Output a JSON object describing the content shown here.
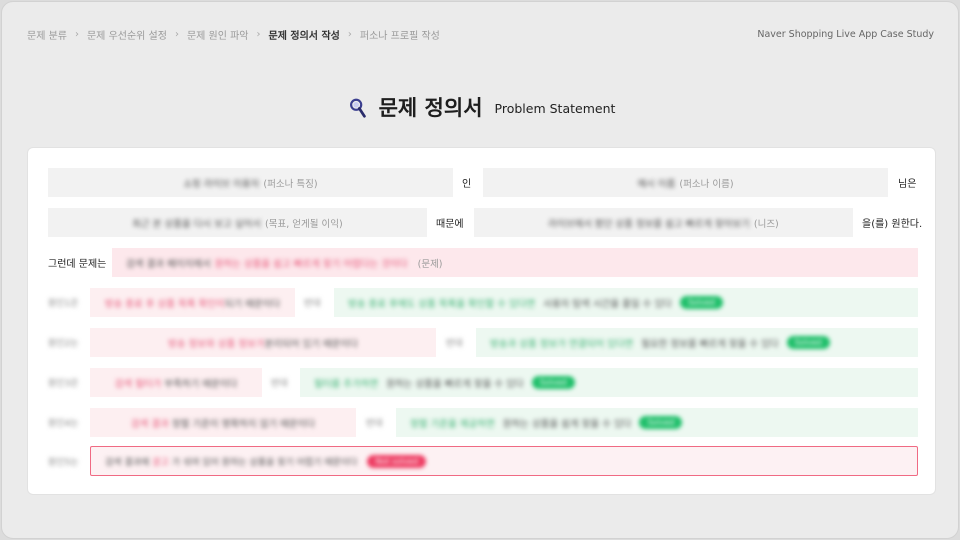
{
  "breadcrumb": {
    "items": [
      {
        "label": "문제 분류"
      },
      {
        "label": "문제 우선순위 설정"
      },
      {
        "label": "문제 원인 파악"
      },
      {
        "label": "문제 정의서 작성"
      },
      {
        "label": "퍼소나 프로필 작성"
      }
    ],
    "active_index": 3
  },
  "brand": "Naver Shopping Live App Case Study",
  "header": {
    "title_ko": "문제 정의서",
    "title_en": "Problem Statement",
    "icon": "magnifier-icon"
  },
  "statement": {
    "row1": {
      "persona_feature_value": "쇼핑 라이브 이용자",
      "persona_feature_placeholder": "(퍼소나 특징)",
      "connector_in": "인",
      "persona_name_value": "예시 이름",
      "persona_name_placeholder": "(퍼소나 이름)",
      "suffix": "님은"
    },
    "row2": {
      "goal_value": "최근 본 상품을 다시 보고 싶어서",
      "goal_placeholder": "(목표, 얻게될 이익)",
      "connector_because": "때문에",
      "need_value": "라이브에서 봤던 상품 정보를 쉽고 빠르게 찾아보기",
      "need_placeholder": "(니즈)",
      "suffix": "을(를) 원한다."
    },
    "row3": {
      "label": "그런데 문제는",
      "value_prefix": "검색 결과 페이지에서",
      "value_highlight": "원하는 상품을 쉽고 빠르게 찾기 어렵다는 것이다",
      "placeholder": "(문제)"
    }
  },
  "causes": [
    {
      "label": "원인1은",
      "left_highlight": "방송 종료 후 상품 목록 확인이",
      "left_tail": "되기 때문이다",
      "because": "반대",
      "right_highlight": "방송 종료 후에도 상품 목록을 확인할 수 있다면",
      "right_tail": "사용자 탐색 시간을 줄일 수 있다",
      "badge": "Solved"
    },
    {
      "label": "원인2는",
      "left_highlight": "방송 정보와 상품 정보가",
      "left_tail": "분리되어 있기 때문이다",
      "because": "반대",
      "right_highlight": "방송과 상품 정보가 연결되어 있다면",
      "right_tail": "필요한 정보를 빠르게 찾을 수 있다",
      "badge": "Solved"
    },
    {
      "label": "원인3은",
      "left_highlight": "검색 필터가",
      "left_tail": "부족하기 때문이다",
      "because": "반대",
      "right_highlight": "필터를 추가하면",
      "right_tail": "원하는 상품을 빠르게 찾을 수 있다",
      "badge": "Solved"
    },
    {
      "label": "원인4는",
      "left_highlight": "검색 결과",
      "left_tail": "정렬 기준이 명확하지 않기 때문이다",
      "because": "반대",
      "right_highlight": "정렬 기준을 제공하면",
      "right_tail": "원하는 상품을 쉽게 찾을 수 있다",
      "badge": "Solved"
    }
  ],
  "cause5": {
    "label": "원인5는",
    "text_prefix": "검색 결과에",
    "text_highlight": "광고",
    "text_tail": "가 섞여 있어 원하는 상품을 찾기 어렵기 때문이다",
    "badge": "Not solved"
  },
  "colors": {
    "accent_green": "#1fbf6a",
    "accent_red": "#ee3d63",
    "highlight_pink": "#e8577a",
    "highlight_green": "#3bb273"
  }
}
